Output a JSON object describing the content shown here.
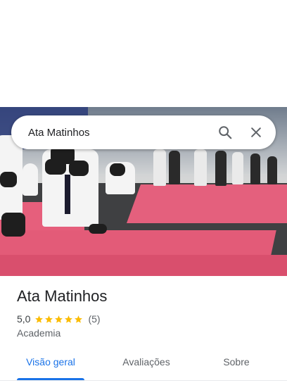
{
  "search": {
    "query": "Ata Matinhos",
    "search_icon": "search-icon",
    "close_icon": "close-icon"
  },
  "place": {
    "name": "Ata Matinhos",
    "rating": "5,0",
    "stars_filled": 5,
    "review_count": "(5)",
    "category": "Academia"
  },
  "tabs": [
    {
      "label": "Visão geral",
      "active": true
    },
    {
      "label": "Avaliações",
      "active": false
    },
    {
      "label": "Sobre",
      "active": false
    }
  ],
  "colors": {
    "accent": "#1a73e8",
    "star": "#fbbc04",
    "text_primary": "#202124",
    "text_secondary": "#5f6368"
  }
}
